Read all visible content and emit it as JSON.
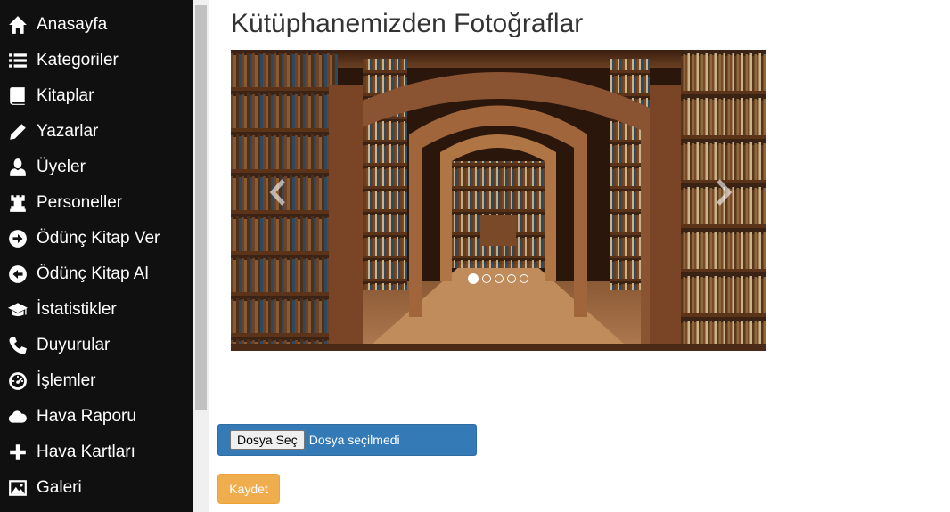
{
  "sidebar": {
    "items": [
      {
        "label": "Anasayfa",
        "icon": "home-icon"
      },
      {
        "label": "Kategoriler",
        "icon": "list-icon"
      },
      {
        "label": "Kitaplar",
        "icon": "book-icon"
      },
      {
        "label": "Yazarlar",
        "icon": "pencil-icon"
      },
      {
        "label": "Üyeler",
        "icon": "user-icon"
      },
      {
        "label": "Personeller",
        "icon": "tower-icon"
      },
      {
        "label": "Ödünç Kitap Ver",
        "icon": "circle-arrow-right-icon"
      },
      {
        "label": "Ödünç Kitap Al",
        "icon": "circle-arrow-left-icon"
      },
      {
        "label": "İstatistikler",
        "icon": "education-icon"
      },
      {
        "label": "Duyurular",
        "icon": "phone-icon"
      },
      {
        "label": "İşlemler",
        "icon": "dashboard-icon"
      },
      {
        "label": "Hava Raporu",
        "icon": "cloud-icon"
      },
      {
        "label": "Hava Kartları",
        "icon": "plus-icon"
      },
      {
        "label": "Galeri",
        "icon": "picture-icon"
      }
    ]
  },
  "main": {
    "title": "Kütüphanemizden Fotoğraflar",
    "carousel": {
      "slide_count": 5,
      "active_index": 0
    },
    "upload": {
      "button_label": "Dosya Seç",
      "status": "Dosya seçilmedi"
    },
    "save_label": "Kaydet"
  },
  "colors": {
    "sidebar_bg": "#101010",
    "upload_bg": "#337ab7",
    "save_bg": "#f0ad4e"
  }
}
